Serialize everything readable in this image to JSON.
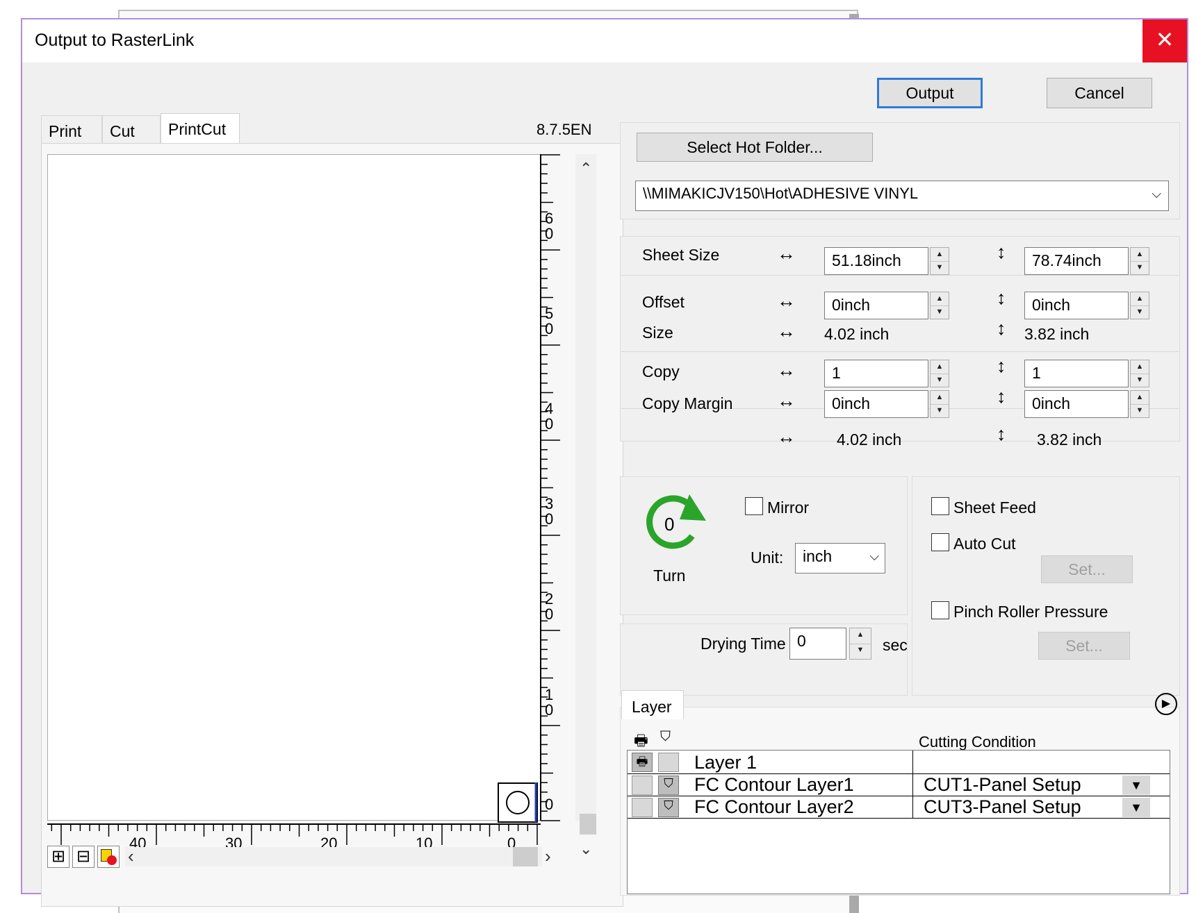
{
  "window": {
    "title": "Output to RasterLink",
    "close_icon": "close-icon"
  },
  "actions": {
    "output": "Output",
    "cancel": "Cancel"
  },
  "tabs": [
    {
      "label": "Print"
    },
    {
      "label": "Cut"
    },
    {
      "label": "PrintCut",
      "selected": true
    }
  ],
  "version": "8.7.5EN",
  "preview": {
    "y_ticks": [
      "6\n0",
      "5\n0",
      "4\n0",
      "3\n0",
      "2\n0",
      "1\n0",
      "0"
    ],
    "x_ticks": [
      "40",
      "30",
      "20",
      "10",
      "0"
    ],
    "tools": [
      "fit-icon",
      "width-fit-icon",
      "color-icon"
    ]
  },
  "hotfolder": {
    "button": "Select Hot Folder...",
    "path": "\\\\MIMAKICJV150\\Hot\\ADHESIVE VINYL"
  },
  "sheet": {
    "sheet_size_label": "Sheet Size",
    "sheet_w": "51.18inch",
    "sheet_h": "78.74inch",
    "offset_label": "Offset",
    "offset_w": "0inch",
    "offset_h": "0inch",
    "size_label": "Size",
    "size_w": "4.02 inch",
    "size_h": "3.82 inch",
    "copy_label": "Copy",
    "copy_w": "1",
    "copy_h": "1",
    "copy_margin_label": "Copy Margin",
    "margin_w": "0inch",
    "margin_h": "0inch",
    "total_w": "4.02 inch",
    "total_h": "3.82 inch"
  },
  "orientation": {
    "turn_value": "0",
    "turn_label": "Turn",
    "mirror_label": "Mirror",
    "unit_label": "Unit:",
    "unit_value": "inch"
  },
  "options": {
    "sheet_feed": "Sheet Feed",
    "auto_cut": "Auto Cut",
    "set1": "Set...",
    "pinch_roller": "Pinch Roller Pressure",
    "set2": "Set..."
  },
  "drying": {
    "label": "Drying Time",
    "value": "0",
    "unit": "sec"
  },
  "layer": {
    "tab": "Layer",
    "cutting_condition_header": "Cutting Condition",
    "rows": [
      {
        "name": "Layer 1",
        "condition": ""
      },
      {
        "name": "FC Contour Layer1",
        "condition": "CUT1-Panel Setup"
      },
      {
        "name": "FC Contour Layer2",
        "condition": "CUT3-Panel Setup"
      }
    ]
  },
  "colors": {
    "accent": "#2f7ad8",
    "close": "#e81123",
    "turn_green": "#2aa52a",
    "border": "#b28ae0"
  }
}
